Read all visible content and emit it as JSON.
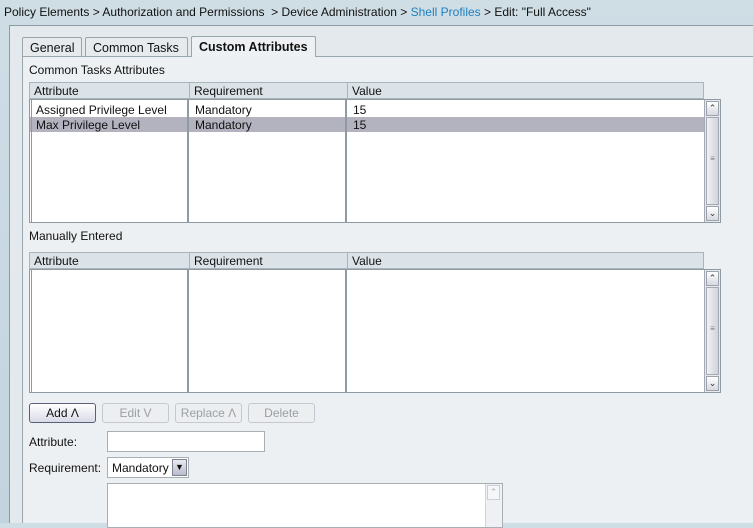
{
  "breadcrumb": {
    "items": [
      "Policy Elements",
      "Authorization and Permissions",
      "Device Administration",
      "Shell Profiles"
    ],
    "separator": ">",
    "current": "Edit: \"Full Access\""
  },
  "tabs": [
    {
      "label": "General"
    },
    {
      "label": "Common Tasks"
    },
    {
      "label": "Custom Attributes",
      "selected": true
    }
  ],
  "common": {
    "title": "Common Tasks Attributes",
    "columns": [
      "Attribute",
      "Requirement",
      "Value"
    ],
    "rows": [
      {
        "attribute": "Assigned Privilege Level",
        "requirement": "Mandatory",
        "value": "15"
      },
      {
        "attribute": "Max Privilege Level",
        "requirement": "Mandatory",
        "value": "15",
        "selected": true
      }
    ]
  },
  "manual": {
    "title": "Manually Entered",
    "columns": [
      "Attribute",
      "Requirement",
      "Value"
    ],
    "rows": []
  },
  "buttons": {
    "add": "Add Λ",
    "edit": "Edit V",
    "replace": "Replace Λ",
    "delete": "Delete"
  },
  "form": {
    "attribute_label": "Attribute:",
    "attribute_value": "",
    "requirement_label": "Requirement:",
    "requirement_value": "Mandatory"
  },
  "colors": {
    "link": "#1f7fc0",
    "selected_row": "#b2b3bf"
  }
}
